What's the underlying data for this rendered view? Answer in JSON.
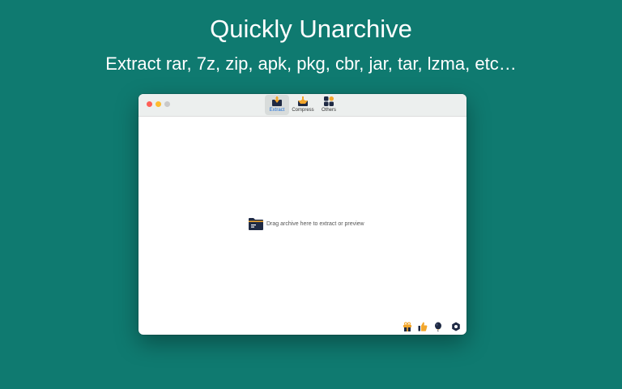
{
  "hero": {
    "title": "Quickly Unarchive",
    "subtitle": "Extract rar, 7z, zip, apk, pkg, cbr, jar, tar, lzma, etc…"
  },
  "toolbar": {
    "tabs": [
      {
        "label": "Extract",
        "icon": "extract-icon",
        "active": true
      },
      {
        "label": "Compress",
        "icon": "compress-icon",
        "active": false
      },
      {
        "label": "Others",
        "icon": "others-icon",
        "active": false
      }
    ]
  },
  "dropzone": {
    "text": "Drag archive here to extract or preview",
    "icon": "archive-folder-icon"
  },
  "footer": {
    "icons": [
      "gift-icon",
      "thumbs-up-icon",
      "balloon-icon",
      "settings-icon"
    ]
  },
  "colors": {
    "background": "#0f7a70",
    "accent": "#1e6fd8",
    "icon_dark": "#1f2a44",
    "icon_gold": "#f2a62b"
  }
}
